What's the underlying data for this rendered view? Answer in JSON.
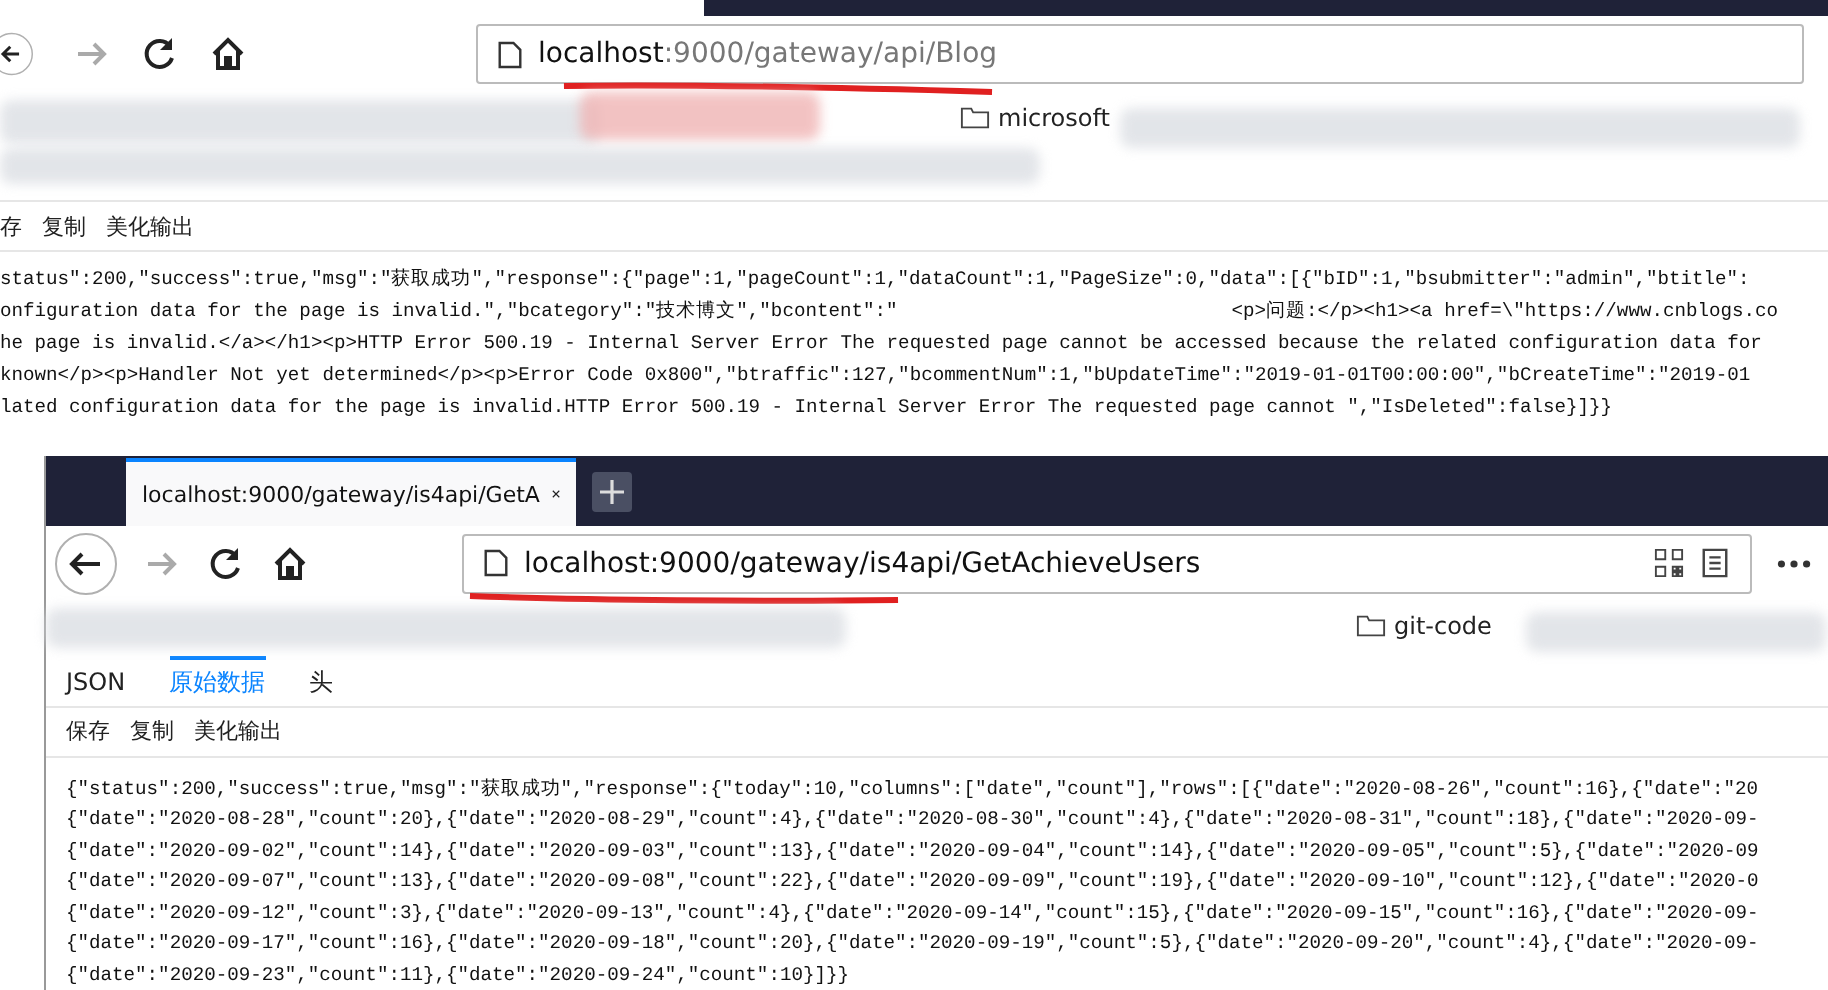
{
  "back_window": {
    "url_host": "localhost",
    "url_rest": ":9000/gateway/api/Blog",
    "bookmarks": [
      {
        "label": "microsoft"
      }
    ],
    "toolbar": [
      "存",
      "复制",
      "美化输出"
    ],
    "code_lines": [
      "status\":200,\"success\":true,\"msg\":\"获取成功\",\"response\":{\"page\":1,\"pageCount\":1,\"dataCount\":1,\"PageSize\":0,\"data\":[{\"bID\":1,\"bsubmitter\":\"admin\",\"btitle\":",
      "onfiguration data for the page is invalid.\",\"bcategory\":\"技术博文\",\"bcontent\":\"                             <p>问题:</p><h1><a href=\\\"https://www.cnblogs.co",
      "he page is invalid.</a></h1><p>HTTP Error 500.19 - Internal Server Error The requested page cannot be accessed because the related configuration data for",
      "known</p><p>Handler Not yet determined</p><p>Error Code 0x800\",\"btraffic\":127,\"bcommentNum\":1,\"bUpdateTime\":\"2019-01-01T00:00:00\",\"bCreateTime\":\"2019-01",
      "lated configuration data for the page is invalid.HTTP Error 500.19 - Internal Server Error The requested page cannot \",\"IsDeleted\":false}]}}"
    ]
  },
  "front_window": {
    "tab": {
      "title": "localhost:9000/gateway/is4api/GetA",
      "selected": true
    },
    "url": "localhost:9000/gateway/is4api/GetAchieveUsers",
    "bookmarks": [
      {
        "label": "git-code"
      }
    ],
    "view_tabs": [
      {
        "label": "JSON",
        "selected": false
      },
      {
        "label": "原始数据",
        "selected": true
      },
      {
        "label": "头",
        "selected": false
      }
    ],
    "toolbar": [
      "保存",
      "复制",
      "美化输出"
    ],
    "code_lines": [
      "{\"status\":200,\"success\":true,\"msg\":\"获取成功\",\"response\":{\"today\":10,\"columns\":[\"date\",\"count\"],\"rows\":[{\"date\":\"2020-08-26\",\"count\":16},{\"date\":\"20",
      "{\"date\":\"2020-08-28\",\"count\":20},{\"date\":\"2020-08-29\",\"count\":4},{\"date\":\"2020-08-30\",\"count\":4},{\"date\":\"2020-08-31\",\"count\":18},{\"date\":\"2020-09-",
      "{\"date\":\"2020-09-02\",\"count\":14},{\"date\":\"2020-09-03\",\"count\":13},{\"date\":\"2020-09-04\",\"count\":14},{\"date\":\"2020-09-05\",\"count\":5},{\"date\":\"2020-09",
      "{\"date\":\"2020-09-07\",\"count\":13},{\"date\":\"2020-09-08\",\"count\":22},{\"date\":\"2020-09-09\",\"count\":19},{\"date\":\"2020-09-10\",\"count\":12},{\"date\":\"2020-0",
      "{\"date\":\"2020-09-12\",\"count\":3},{\"date\":\"2020-09-13\",\"count\":4},{\"date\":\"2020-09-14\",\"count\":15},{\"date\":\"2020-09-15\",\"count\":16},{\"date\":\"2020-09-",
      "{\"date\":\"2020-09-17\",\"count\":16},{\"date\":\"2020-09-18\",\"count\":20},{\"date\":\"2020-09-19\",\"count\":5},{\"date\":\"2020-09-20\",\"count\":4},{\"date\":\"2020-09-",
      "{\"date\":\"2020-09-23\",\"count\":11},{\"date\":\"2020-09-24\",\"count\":10}]}}"
    ]
  }
}
